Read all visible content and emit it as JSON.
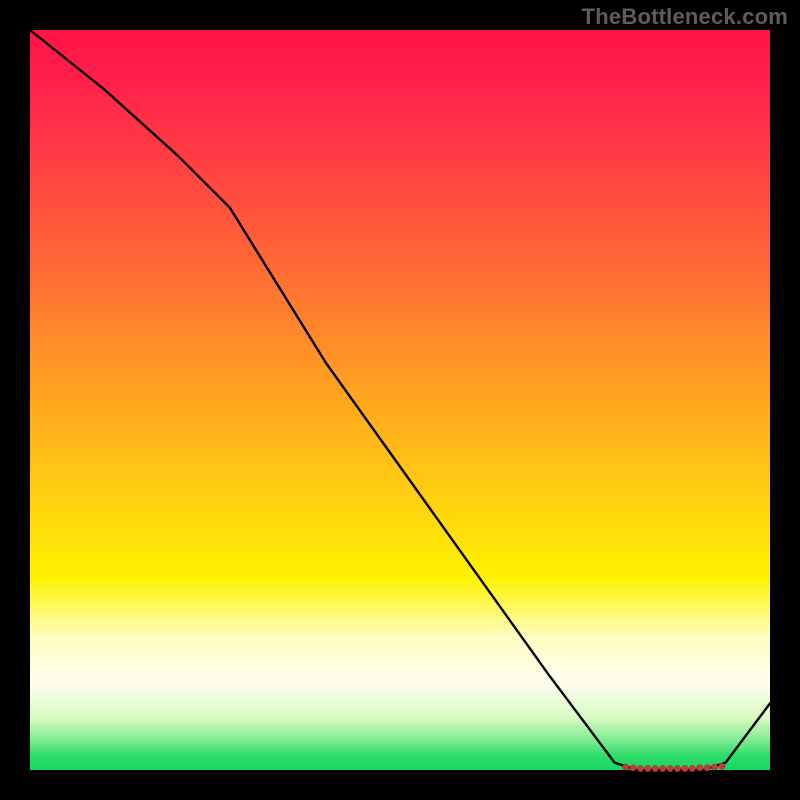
{
  "watermark": "TheBottleneck.com",
  "chart_data": {
    "type": "line",
    "title": "",
    "xlabel": "",
    "ylabel": "",
    "xlim": [
      0,
      100
    ],
    "ylim": [
      0,
      100
    ],
    "grid": false,
    "legend": false,
    "background_gradient": {
      "stops": [
        {
          "pos": 0.0,
          "color": "#ff1446"
        },
        {
          "pos": 0.16,
          "color": "#ff3a45"
        },
        {
          "pos": 0.32,
          "color": "#ff6a35"
        },
        {
          "pos": 0.48,
          "color": "#ffa021"
        },
        {
          "pos": 0.64,
          "color": "#ffd210"
        },
        {
          "pos": 0.74,
          "color": "#fff300"
        },
        {
          "pos": 0.88,
          "color": "#fffef0"
        },
        {
          "pos": 0.96,
          "color": "#6de889"
        },
        {
          "pos": 1.0,
          "color": "#17d85f"
        }
      ]
    },
    "series": [
      {
        "name": "curve",
        "x": [
          0,
          10,
          20,
          27,
          40,
          55,
          70,
          79,
          82,
          85,
          88,
          91,
          94,
          100
        ],
        "y": [
          100,
          92,
          83,
          76,
          55,
          34,
          13,
          1,
          0,
          0,
          0,
          0,
          1,
          9
        ]
      }
    ],
    "markers": {
      "name": "highlight-band",
      "color": "#c23b3b",
      "x": [
        80.5,
        81.5,
        82.5,
        83.5,
        84.5,
        85.5,
        86.5,
        87.5,
        88.5,
        89.5,
        90.5,
        91.5,
        92.5,
        93.5
      ],
      "y": [
        0.4,
        0.3,
        0.2,
        0.2,
        0.2,
        0.2,
        0.2,
        0.2,
        0.2,
        0.2,
        0.3,
        0.3,
        0.4,
        0.5
      ]
    }
  }
}
